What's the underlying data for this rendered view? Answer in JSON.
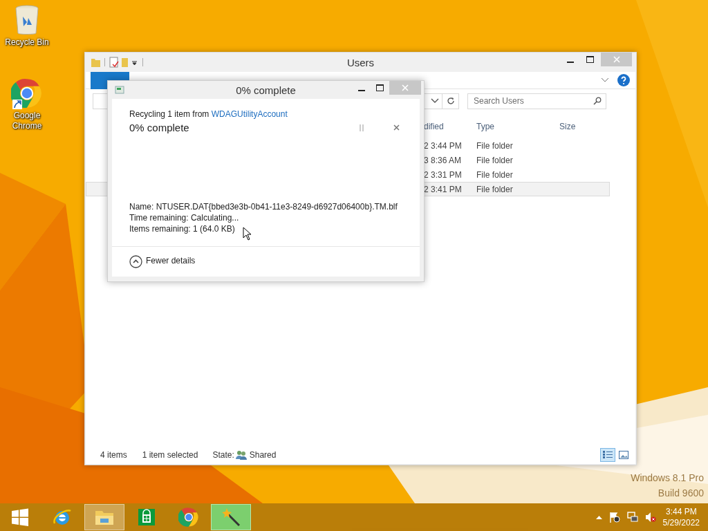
{
  "desktop_icons": [
    {
      "kind": "recycle-bin",
      "label": "Recycle Bin"
    },
    {
      "kind": "chrome",
      "label": "Google Chrome"
    }
  ],
  "explorer": {
    "title": "Users",
    "search": {
      "placeholder": "Search Users"
    },
    "columns": [
      "dified",
      "Type",
      "Size"
    ],
    "rows": [
      {
        "modified": "2 3:44 PM",
        "type": "File folder",
        "selected": false
      },
      {
        "modified": "3 8:36 AM",
        "type": "File folder",
        "selected": false
      },
      {
        "modified": "2 3:31 PM",
        "type": "File folder",
        "selected": false
      },
      {
        "modified": "2 3:41 PM",
        "type": "File folder",
        "selected": true
      }
    ],
    "status_bar": {
      "count": "4 items",
      "selection": "1 item selected",
      "state_label": "State:",
      "state": "Shared"
    },
    "views": [
      {
        "kind": "details",
        "selected": true
      },
      {
        "kind": "large-icons",
        "selected": false
      }
    ]
  },
  "dialog": {
    "title": "0% complete",
    "message": "Recycling 1 item from",
    "source": "WDAGUtilityAccount",
    "progress_text": "0% complete",
    "details": [
      {
        "label": "Name:",
        "value": "NTUSER.DAT{bbed3e3b-0b41-11e3-8249-d6927d06400b}.TM.blf"
      },
      {
        "label": "Time remaining:",
        "value": "Calculating..."
      },
      {
        "label": "Items remaining:",
        "value": "1 (64.0 KB)"
      }
    ],
    "toggle": "Fewer details"
  },
  "os_edition": [
    "Windows 8.1 Pro",
    "Build 9600"
  ],
  "taskbar": {
    "apps": [
      {
        "kind": "start",
        "active": false
      },
      {
        "kind": "browser",
        "active": false
      },
      {
        "kind": "files",
        "active": true
      },
      {
        "kind": "store",
        "active": false
      },
      {
        "kind": "chrome",
        "active": false
      },
      {
        "kind": "wand",
        "active": true
      }
    ],
    "time": "3:44 PM",
    "date": "5/29/2022"
  }
}
